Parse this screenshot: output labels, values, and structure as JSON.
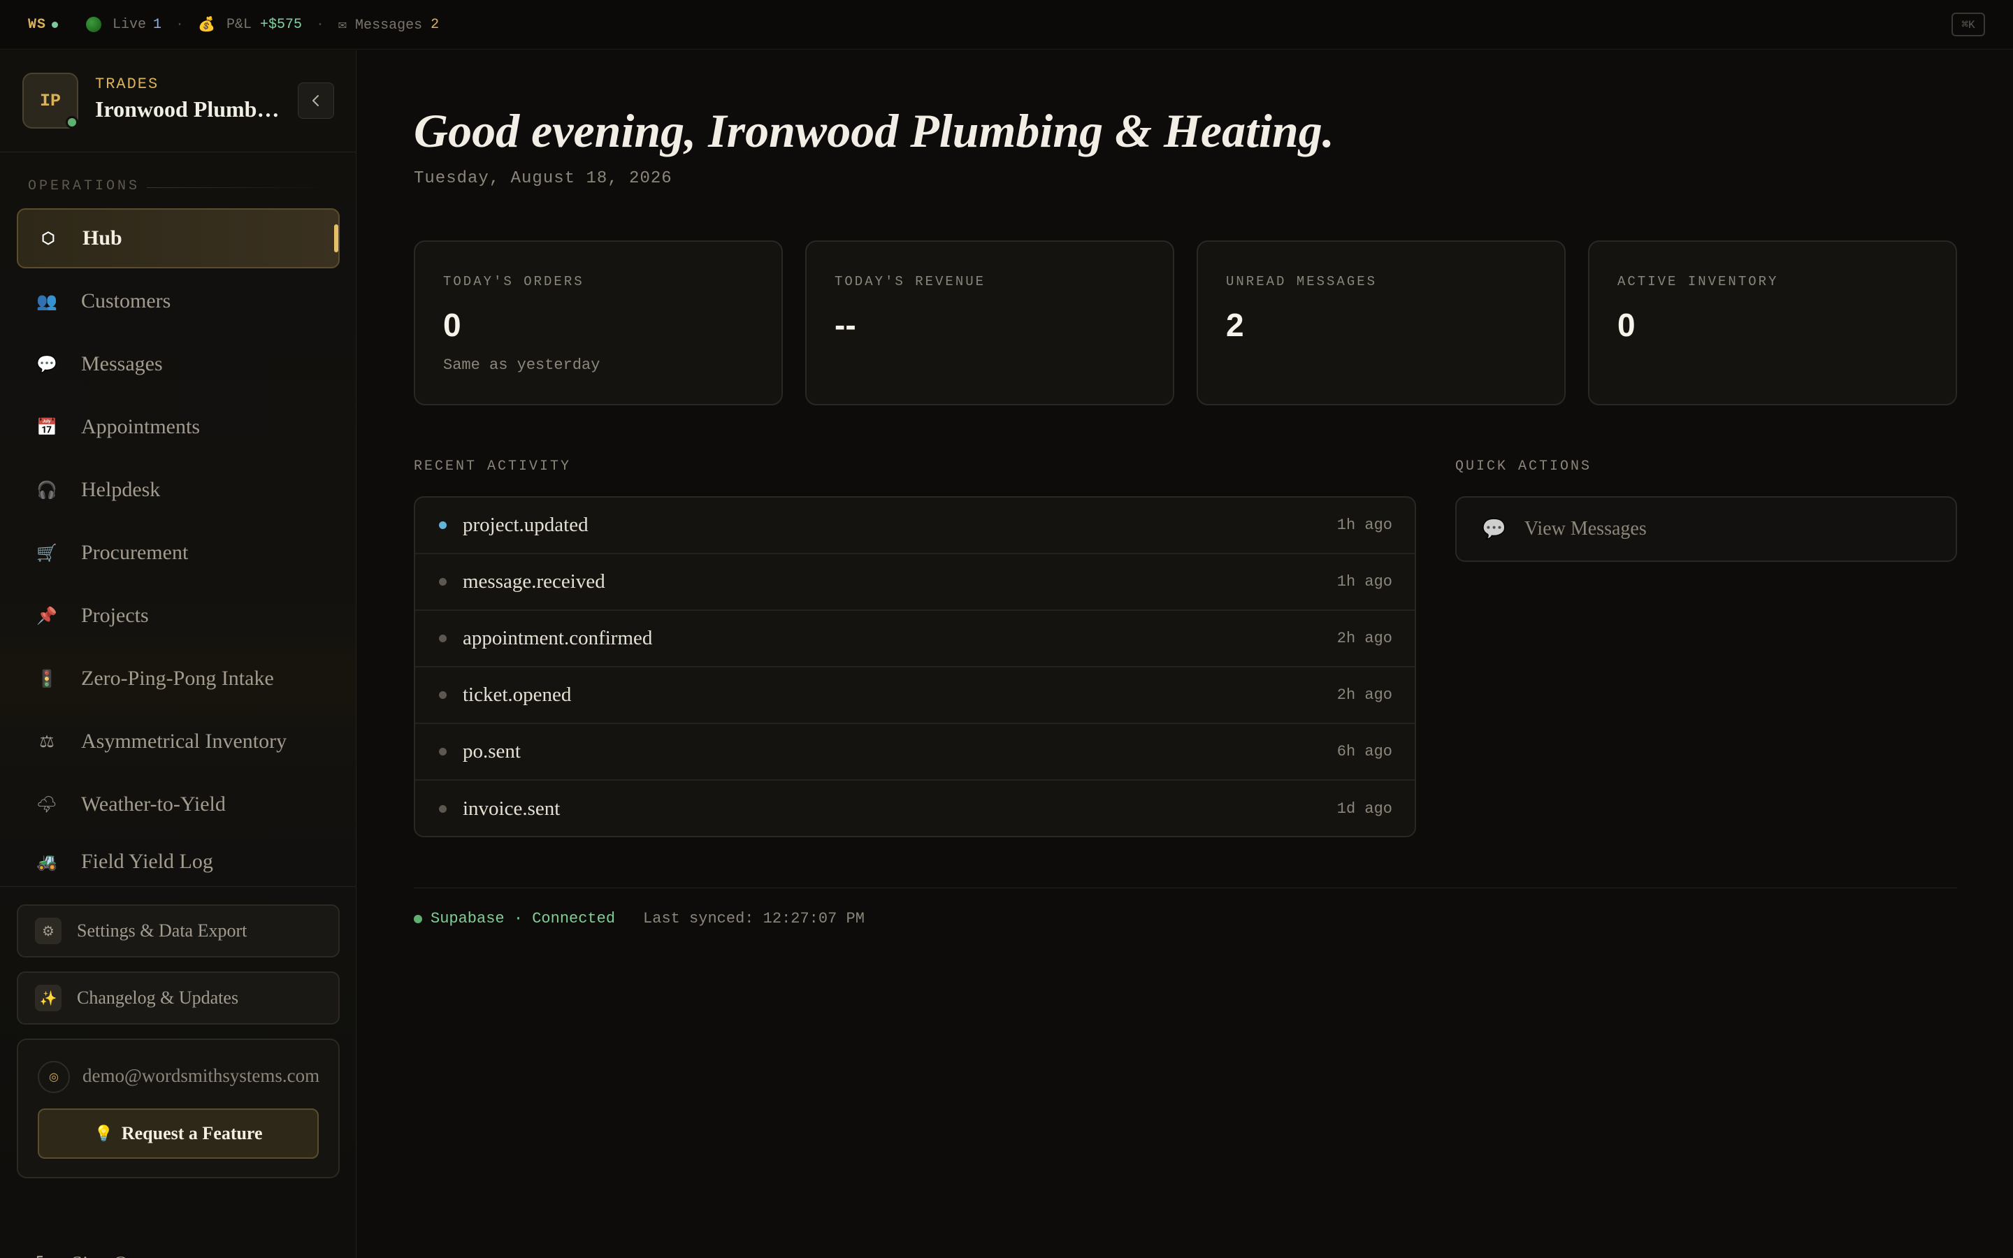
{
  "topbar": {
    "brand": "WS",
    "live_label": "Live",
    "live_count": "1",
    "pnl_label": "P&L",
    "pnl_value": "+$575",
    "messages_label": "✉ Messages",
    "messages_count": "2",
    "shortcut": "⌘K"
  },
  "workspace": {
    "initials": "IP",
    "type": "TRADES",
    "name": "Ironwood Plumbing & Heating"
  },
  "sidebar": {
    "section_label": "OPERATIONS",
    "items": [
      {
        "label": "Hub",
        "icon": "⬡",
        "active": true
      },
      {
        "label": "Customers",
        "icon": "👥"
      },
      {
        "label": "Messages",
        "icon": "💬"
      },
      {
        "label": "Appointments",
        "icon": "📅"
      },
      {
        "label": "Helpdesk",
        "icon": "🎧"
      },
      {
        "label": "Procurement",
        "icon": "🛒"
      },
      {
        "label": "Projects",
        "icon": "📌"
      },
      {
        "label": "Zero-Ping-Pong Intake",
        "icon": "🚦"
      },
      {
        "label": "Asymmetrical Inventory",
        "icon": "⚖"
      },
      {
        "label": "Weather-to-Yield",
        "icon": "🌩"
      },
      {
        "label": "Field Yield Log",
        "icon": "🚜"
      }
    ],
    "settings_label": "Settings & Data Export",
    "settings_icon": "⚙",
    "changelog_label": "Changelog & Updates",
    "changelog_icon": "✨",
    "user_email": "demo@wordsmithsystems.com",
    "feature_button": "Request a Feature",
    "feature_icon": "💡",
    "signout_label": "Sign Out"
  },
  "main": {
    "greeting": "Good evening, Ironwood Plumbing & Heating.",
    "date": "Tuesday, August 18, 2026",
    "stats": [
      {
        "label": "TODAY'S ORDERS",
        "value": "0",
        "sub": "Same as yesterday"
      },
      {
        "label": "TODAY'S REVENUE",
        "value": "--",
        "sub": ""
      },
      {
        "label": "UNREAD MESSAGES",
        "value": "2",
        "sub": ""
      },
      {
        "label": "ACTIVE INVENTORY",
        "value": "0",
        "sub": ""
      }
    ],
    "recent_activity_label": "RECENT ACTIVITY",
    "activity": [
      {
        "event": "project.updated",
        "time": "1h ago"
      },
      {
        "event": "message.received",
        "time": "1h ago"
      },
      {
        "event": "appointment.confirmed",
        "time": "2h ago"
      },
      {
        "event": "ticket.opened",
        "time": "2h ago"
      },
      {
        "event": "po.sent",
        "time": "6h ago"
      },
      {
        "event": "invoice.sent",
        "time": "1d ago"
      }
    ],
    "quick_actions_label": "QUICK ACTIONS",
    "quick_actions": [
      {
        "label": "View Messages",
        "icon": "💬"
      }
    ],
    "db_status": "Supabase · Connected",
    "last_synced": "Last synced: 12:27:07 PM"
  },
  "colors": {
    "accent": "#d9b25a",
    "background": "#0d0c0a",
    "connected": "#5fb070",
    "activity_new": "#62b4d8"
  }
}
